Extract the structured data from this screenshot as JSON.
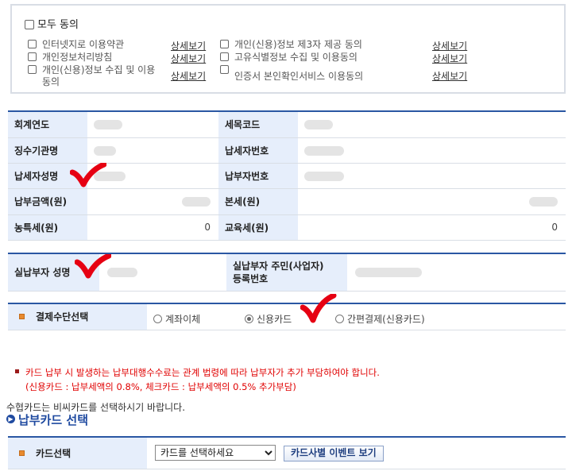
{
  "agreement": {
    "all_label": "모두 동의",
    "terms": [
      {
        "label": "인터넷지로 이용약관",
        "more": "상세보기"
      },
      {
        "label": "개인정보처리방침",
        "more": "상세보기"
      },
      {
        "label": "개인(신용)정보 수집 및 이용",
        "label2": "동의",
        "more": "상세보기"
      },
      {
        "label": "개인(신용)정보 제3자 제공 동의",
        "more": "상세보기"
      },
      {
        "label": "고유식별정보 수집 및 이용동의",
        "more": "상세보기"
      },
      {
        "label": "인증서 본인확인서비스 이용동의",
        "more": "상세보기"
      }
    ]
  },
  "payment_info": {
    "fiscal_year_label": "회계연도",
    "tax_code_label": "세목코드",
    "collector_label": "징수기관명",
    "taxpayer_no_label": "납세자번호",
    "taxpayer_name_label": "납세자성명",
    "payer_no_label": "납부자번호",
    "amount_label": "납부금액(원)",
    "principal_label": "본세(원)",
    "rural_tax_label": "농특세(원)",
    "rural_tax_value": "0",
    "edu_tax_label": "교육세(원)",
    "edu_tax_value": "0"
  },
  "actual_payer": {
    "name_label": "실납부자 성명",
    "id_label_1": "실납부자 주민(사업자)",
    "id_label_2": "등록번호"
  },
  "payment_method": {
    "label": "결제수단선택",
    "options": [
      "계좌이체",
      "신용카드",
      "간편결제(신용카드)"
    ],
    "selected": "신용카드"
  },
  "notice": {
    "line1": "카드 납부 시 발생하는 납부대행수수료는 관계 법령에 따라 납부자가 추가 부담하여야 합니다.",
    "line2": "(신용카드 : 납부세액의 0.8%, 체크카드 : 납부세액의 0.5% 추가부담)"
  },
  "card_section": {
    "hint": "수협카드는 비씨카드를 선택하시기 바랍니다.",
    "title": "납부카드 선택",
    "row_label": "카드선택",
    "select_value": "카드를 선택하세요",
    "event_button": "카드사별 이벤트 보기"
  },
  "colors": {
    "header_bg": "#e6eefb",
    "table_border": "#2a57a3",
    "notice_red": "#e00000",
    "check_red": "#e60012",
    "title_blue": "#1f4aa0"
  }
}
